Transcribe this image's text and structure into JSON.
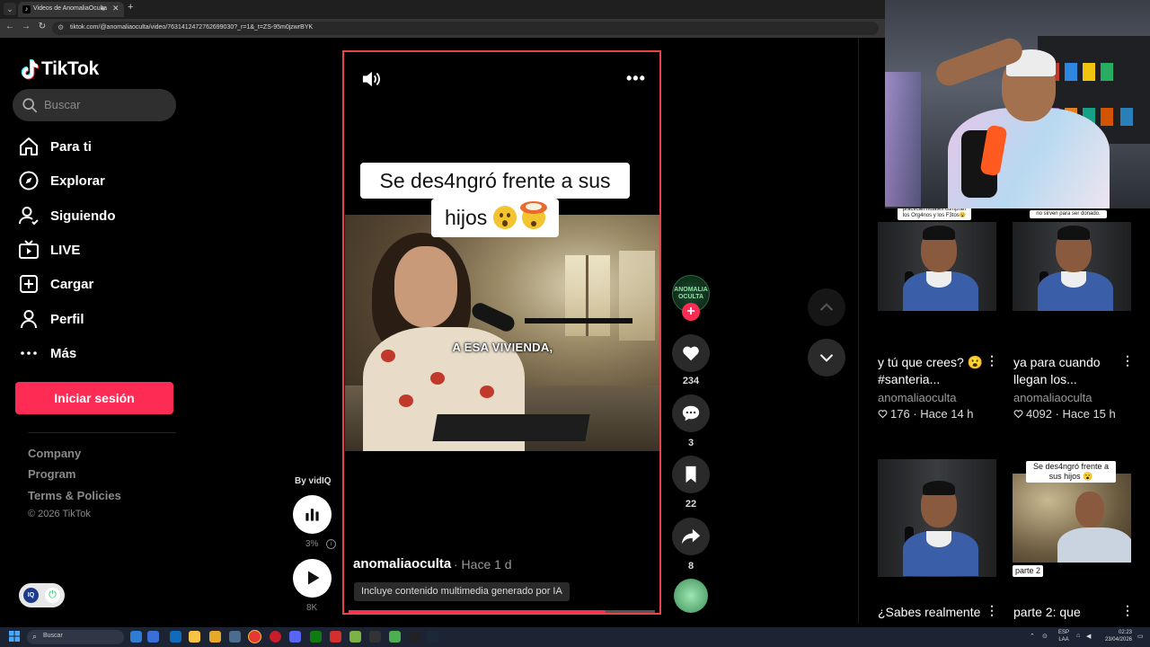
{
  "browser": {
    "tab_title": "Videos de AnomaliaOculta",
    "tab_favicon": "tiktok-icon",
    "url": "tiktok.com/@anomaliaoculta/video/7631412472762699030?_r=1&_t=ZS-95m0jzwrBYK"
  },
  "sidebar": {
    "logo_text": "TikTok",
    "search_placeholder": "Buscar",
    "nav": [
      {
        "label": "Para ti",
        "icon": "home-icon"
      },
      {
        "label": "Explorar",
        "icon": "compass-icon"
      },
      {
        "label": "Siguiendo",
        "icon": "following-icon"
      },
      {
        "label": "LIVE",
        "icon": "live-icon"
      },
      {
        "label": "Cargar",
        "icon": "upload-icon"
      },
      {
        "label": "Perfil",
        "icon": "profile-icon"
      },
      {
        "label": "Más",
        "icon": "more-icon"
      }
    ],
    "login_label": "Iniciar sesión",
    "footer_links": [
      "Company",
      "Program",
      "Terms & Policies"
    ],
    "copyright": "© 2026 TikTok"
  },
  "vidiq": {
    "by_label": "By vidIQ",
    "score_pct": "3%",
    "views": "8K"
  },
  "video": {
    "caption_line1": "Se des4ngró frente a sus",
    "caption_line2": "hijos",
    "caption_emojis": [
      "astonished-face",
      "exploding-head"
    ],
    "subtitle": "A ESA VIVIENDA,",
    "author": "anomaliaoculta",
    "posted": "· Hace 1 d",
    "ai_label": "Incluye contenido multimedia generado por IA",
    "progress": 0.84
  },
  "actions": {
    "avatar_text": "ANOMALIA OCULTA",
    "likes": "234",
    "comments": "3",
    "saves": "22",
    "shares": "8"
  },
  "related": [
    {
      "title": "y tú que crees? 😮 #santeria...",
      "author": "anomaliaoculta",
      "likes": "176",
      "time": "Hace 14 h",
      "thumb_caption": "practican rituales compran los Org4nos y los F3tos😮"
    },
    {
      "title": "ya para cuando llegan los...",
      "author": "anomaliaoculta",
      "likes": "4092",
      "time": "Hace 15 h",
      "thumb_caption": "no sirven para ser donado."
    },
    {
      "title": "¿Sabes realmente",
      "author": "",
      "likes": "",
      "time": "",
      "thumb_caption": ""
    },
    {
      "title": "parte 2: que",
      "author": "",
      "likes": "",
      "time": "",
      "thumb_caption": "Se des4ngró frente a sus hijos 😮",
      "thumb_caption2": "parte 2"
    }
  ],
  "taskbar": {
    "search_label": "Buscar",
    "lang": "ESP",
    "lang2": "LAA",
    "time": "02:23",
    "date": "23/04/2026"
  },
  "colors": {
    "brand": "#fe2c55",
    "video_border": "#e6434a"
  }
}
